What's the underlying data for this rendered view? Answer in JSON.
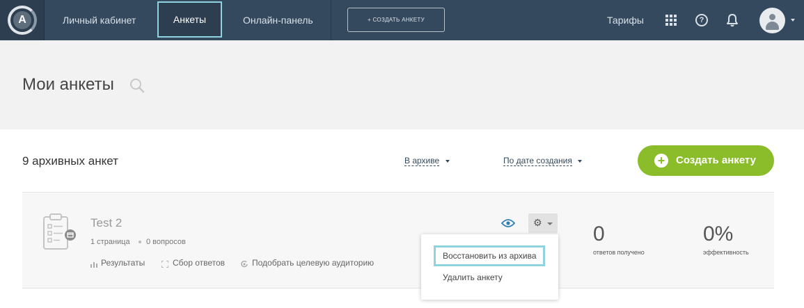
{
  "nav": {
    "logo_letter": "A",
    "items": [
      {
        "label": "Личный кабинет"
      },
      {
        "label": "Анкеты"
      },
      {
        "label": "Онлайн-панель"
      }
    ],
    "create_label": "+ СОЗДАТЬ АНКЕТУ",
    "tariffs_label": "Тарифы",
    "help_glyph": "?",
    "icons": [
      "apps-grid-icon",
      "help-icon",
      "bell-icon",
      "user-avatar-icon",
      "chevron-down-icon"
    ]
  },
  "header": {
    "title": "Мои анкеты",
    "search_icon": "search-icon"
  },
  "toolbar": {
    "count_title": "9 архивных анкет",
    "status_filter": "В архиве",
    "sort_filter": "По дате создания",
    "create_button": "Создать анкету",
    "create_plus": "+"
  },
  "survey": {
    "name": "Test 2",
    "pages": "1 страница",
    "questions": "0 вопросов",
    "links": [
      {
        "label": "Результаты",
        "icon": "bar-chart-icon"
      },
      {
        "label": "Сбор ответов",
        "icon": "collect-icon"
      },
      {
        "label": "Подобрать целевую аудиторию",
        "icon": "target-icon"
      }
    ],
    "stats": [
      {
        "value": "0",
        "label": "ответов получено"
      },
      {
        "value": "0%",
        "label": "эффективность"
      }
    ],
    "gear_glyph": "⚙"
  },
  "dropdown": {
    "items": [
      {
        "label": "Восстановить из архива"
      },
      {
        "label": "Удалить анкету"
      }
    ]
  },
  "colors": {
    "nav_bg": "#34495e",
    "accent_green": "#8bbd2a",
    "highlight_border": "#8fd3e0"
  }
}
